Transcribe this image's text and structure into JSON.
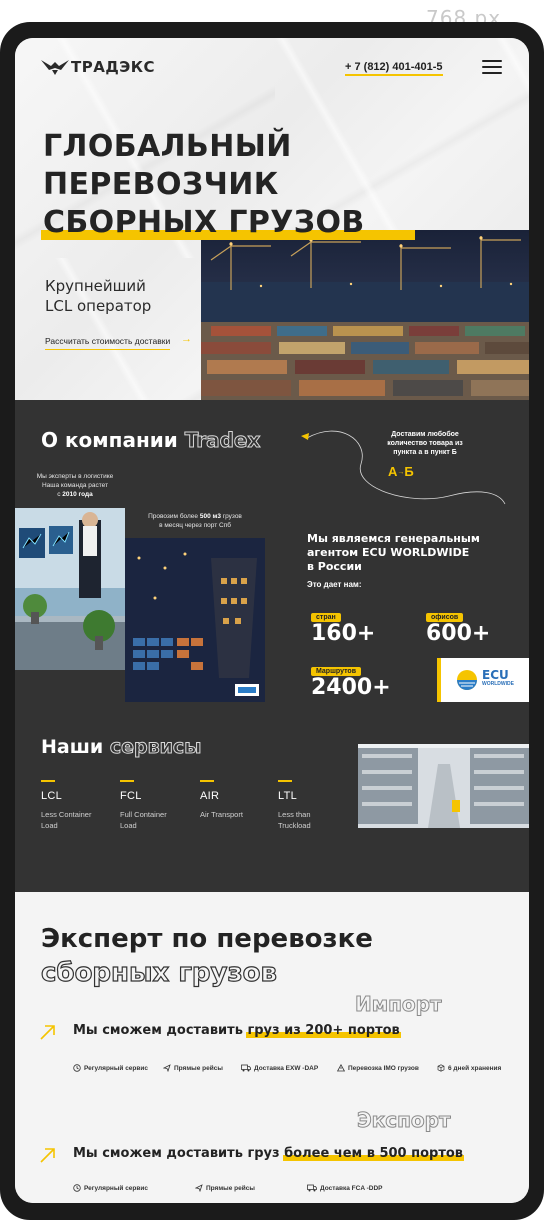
{
  "viewport_label": "768 px",
  "header": {
    "logo_text": "ТРАДЭКС",
    "phone": "+ 7 (812) 401-401-5"
  },
  "hero": {
    "title_lines": [
      "ГЛОБАЛЬНЫЙ",
      "ПЕРЕВОЗЧИК",
      "СБОРНЫХ ГРУЗОВ"
    ],
    "subtitle_lines": [
      "Крупнейший",
      "LCL оператор"
    ],
    "cta_link": "Рассчитать стоимость доставки"
  },
  "about": {
    "title_plain": "О компании",
    "title_outline": "Tradex",
    "delivery_lines": [
      "Доставим любобое",
      "количество товара из",
      "пункта а в пункт Б"
    ],
    "route_from": "А",
    "route_to": "Б",
    "expert_lines": [
      "Мы эксперты в логистике",
      "Наша команда растет"
    ],
    "since_prefix": "с",
    "since_year": "2010 года",
    "volume_line_1a": "Провозим более",
    "volume_line_1b": "500 м3",
    "volume_line_1c": "грузов",
    "volume_line_2": "в месяц через порт Спб",
    "agent_lines": [
      "Мы являемся генеральным",
      "агентом ECU WORLDWIDE",
      "в России"
    ],
    "gives_label": "Это дает нам:",
    "stats": [
      {
        "label": "стран",
        "value": "160+"
      },
      {
        "label": "офисов",
        "value": "600+"
      },
      {
        "label": "Маршрутов",
        "value": "2400+"
      }
    ],
    "ecu_logo_text": "ECU",
    "ecu_logo_sub": "WORLDWIDE"
  },
  "services": {
    "title_plain": "Наши",
    "title_outline": "сервисы",
    "items": [
      {
        "code": "LCL",
        "desc_lines": [
          "Less Container",
          "Load"
        ]
      },
      {
        "code": "FCL",
        "desc_lines": [
          "Full Container",
          "Load"
        ]
      },
      {
        "code": "AIR",
        "desc_lines": [
          "Air Transport"
        ]
      },
      {
        "code": "LTL",
        "desc_lines": [
          "Less than",
          "Truckload"
        ]
      }
    ]
  },
  "expert": {
    "title_line_1": "Эксперт по перевозке",
    "title_line_2": "сборных грузов",
    "import": {
      "ghost": "Импорт",
      "text_plain": "Мы сможем доставить",
      "text_highlight": "груз из 200+ портов",
      "features": [
        "Регулярный сервис",
        "Прямые рейсы",
        "Доставка EXW -DAP",
        "Перевозка IMO грузов",
        "6 дней хранения"
      ]
    },
    "export": {
      "ghost": "Экспорт",
      "text_plain": "Мы сможем доставить груз",
      "text_highlight": "более чем в 500 портов",
      "features": [
        "Регулярный сервис",
        "Прямые рейсы",
        "Доставка FCA -DDP"
      ]
    }
  },
  "colors": {
    "accent": "#f5c400",
    "dark_bg": "#333333",
    "light_bg": "#f4f4f4",
    "text_dark": "#232323"
  }
}
